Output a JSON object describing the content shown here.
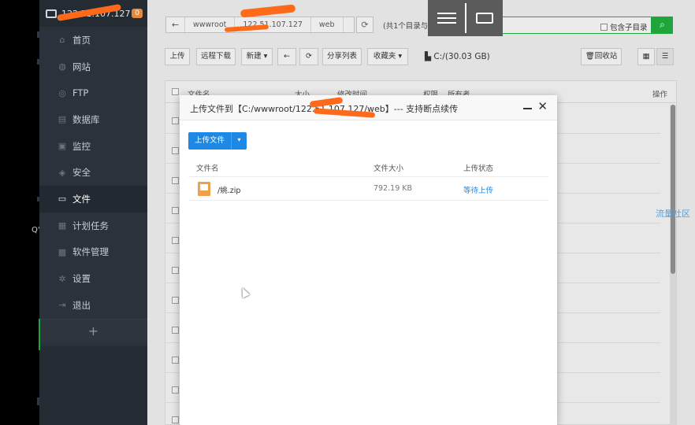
{
  "sidebar": {
    "server_ip": "122.51.107.127",
    "badge": "0",
    "items": [
      {
        "label": "首页",
        "icon": "home-icon",
        "glyph": "⌂"
      },
      {
        "label": "网站",
        "icon": "globe-icon",
        "glyph": "◍"
      },
      {
        "label": "FTP",
        "icon": "ftp-icon",
        "glyph": "◎"
      },
      {
        "label": "数据库",
        "icon": "database-icon",
        "glyph": "▤"
      },
      {
        "label": "监控",
        "icon": "monitor-icon",
        "glyph": "▣"
      },
      {
        "label": "安全",
        "icon": "shield-icon",
        "glyph": "◈"
      },
      {
        "label": "文件",
        "icon": "folder-icon",
        "glyph": "▭"
      },
      {
        "label": "计划任务",
        "icon": "calendar-icon",
        "glyph": "▦"
      },
      {
        "label": "软件管理",
        "icon": "apps-icon",
        "glyph": "▩"
      },
      {
        "label": "设置",
        "icon": "gear-icon",
        "glyph": "✲"
      },
      {
        "label": "退出",
        "icon": "logout-icon",
        "glyph": "⇥"
      }
    ],
    "add_label": "+"
  },
  "path": {
    "crumbs": [
      "wwwroot",
      "122.51.107.127",
      "web"
    ],
    "dir_count": "(共1个目录与1个文件,大小:2.99 MB 获",
    "subdir_label": "包含子目录"
  },
  "toolbar": {
    "upload": "上传",
    "remote_download": "远程下载",
    "new": "新建",
    "share_list": "分享列表",
    "favorites": "收藏夹",
    "drive": "C:/(30.03 GB)",
    "recycle": "回收站"
  },
  "table": {
    "headers": {
      "name": "文件名",
      "size": "大小",
      "modified": "修改时间",
      "perm": "权限",
      "owner": "所有者",
      "ops": "操作"
    }
  },
  "community_link": "流量社区",
  "side_letter": "Q'",
  "modal": {
    "title": "上传文件到【C:/wwwroot/122.51.107.127/web】--- 支持断点续传",
    "upload_button": "上传文件",
    "columns": {
      "name": "文件名",
      "size": "文件大小",
      "status": "上传状态"
    },
    "files": [
      {
        "name": "/姚.zip",
        "size": "792.19 KB",
        "status": "等待上传"
      }
    ]
  },
  "colors": {
    "accent_green": "#20a53a",
    "accent_blue": "#1e88e5",
    "sidebar_bg": "#2b323b",
    "annotation_orange": "#ff6a1a"
  }
}
